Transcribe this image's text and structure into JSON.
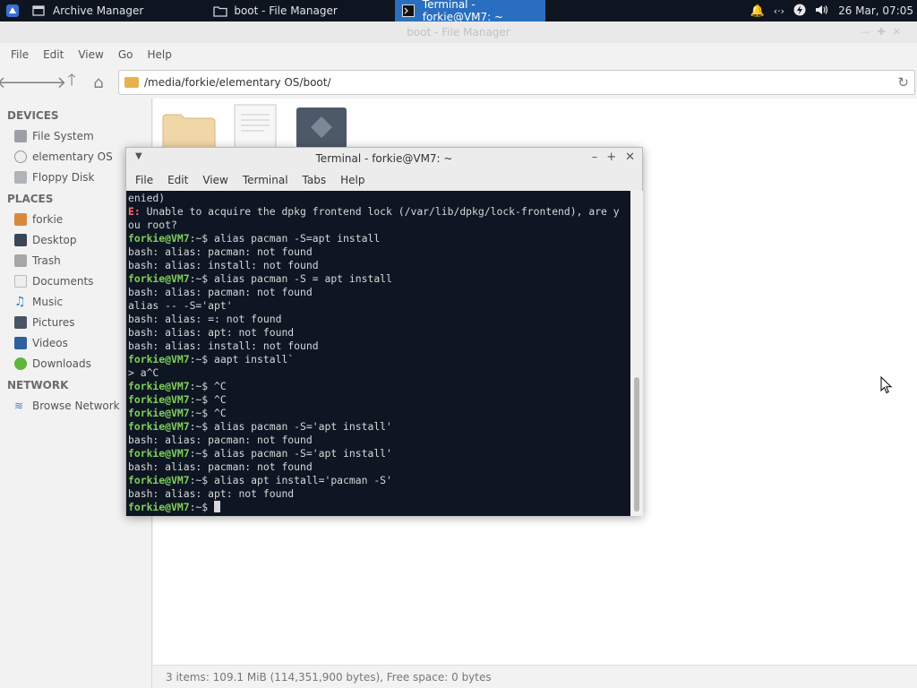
{
  "taskbar": {
    "tasks": [
      {
        "label": "Archive Manager"
      },
      {
        "label": "boot - File Manager"
      },
      {
        "label": "Terminal - forkie@VM7: ~"
      }
    ],
    "clock": "26 Mar, 07:05"
  },
  "file_manager": {
    "title": "boot - File Manager",
    "menu": [
      "File",
      "Edit",
      "View",
      "Go",
      "Help"
    ],
    "path": "/media/forkie/elementary OS/boot/",
    "sidebar": {
      "devices_title": "DEVICES",
      "devices": [
        "File System",
        "elementary OS",
        "Floppy Disk"
      ],
      "places_title": "PLACES",
      "places": [
        "forkie",
        "Desktop",
        "Trash",
        "Documents",
        "Music",
        "Pictures",
        "Videos",
        "Downloads"
      ],
      "network_title": "NETWORK",
      "network": [
        "Browse Network"
      ]
    },
    "status": "3 items: 109.1 MiB (114,351,900 bytes), Free space: 0 bytes"
  },
  "terminal": {
    "title": "Terminal - forkie@VM7: ~",
    "menu": [
      "File",
      "Edit",
      "View",
      "Terminal",
      "Tabs",
      "Help"
    ],
    "prompt_user": "forkie@VM7",
    "prompt_path": ":~$ ",
    "lines": [
      {
        "type": "text",
        "text": "enied)"
      },
      {
        "type": "error",
        "label": "E:",
        "text": " Unable to acquire the dpkg frontend lock (/var/lib/dpkg/lock-frontend), are y"
      },
      {
        "type": "text",
        "text": "ou root?"
      },
      {
        "type": "prompt",
        "text": "alias pacman -S=apt install"
      },
      {
        "type": "text",
        "text": "bash: alias: pacman: not found"
      },
      {
        "type": "text",
        "text": "bash: alias: install: not found"
      },
      {
        "type": "prompt",
        "text": "alias pacman -S = apt install"
      },
      {
        "type": "text",
        "text": "bash: alias: pacman: not found"
      },
      {
        "type": "text",
        "text": "alias -- -S='apt'"
      },
      {
        "type": "text",
        "text": "bash: alias: =: not found"
      },
      {
        "type": "text",
        "text": "bash: alias: apt: not found"
      },
      {
        "type": "text",
        "text": "bash: alias: install: not found"
      },
      {
        "type": "prompt",
        "text": "aapt install`"
      },
      {
        "type": "text",
        "text": "> a^C"
      },
      {
        "type": "prompt",
        "text": "^C"
      },
      {
        "type": "prompt",
        "text": "^C"
      },
      {
        "type": "prompt",
        "text": "^C"
      },
      {
        "type": "prompt",
        "text": "alias pacman -S='apt install'"
      },
      {
        "type": "text",
        "text": "bash: alias: pacman: not found"
      },
      {
        "type": "prompt",
        "text": "alias pacman -S='apt install'"
      },
      {
        "type": "text",
        "text": "bash: alias: pacman: not found"
      },
      {
        "type": "prompt",
        "text": "alias apt install='pacman -S'"
      },
      {
        "type": "text",
        "text": "bash: alias: apt: not found"
      },
      {
        "type": "cursor",
        "text": ""
      }
    ]
  }
}
